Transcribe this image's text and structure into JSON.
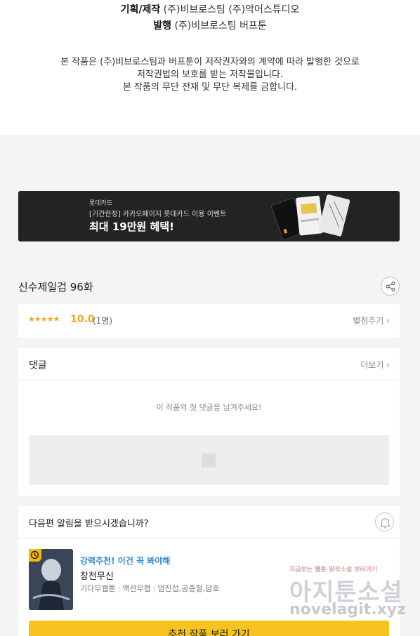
{
  "credits": {
    "planning_label": "기획/제작",
    "planning_value": "(주)비브로스팀   (주)악어스튜디오",
    "publish_label": "발행",
    "publish_value": "(주)비브로스팀   버프툰"
  },
  "notice": {
    "line1": "본 작품은 (주)비브로스팀과 버프툰이 저작권자와의 계약에 따라 발행한 것으로",
    "line2": "저작권법의 보호를 받는 저작물입니다.",
    "line3": "본 작품의 무단 전재 및 무단 복제를 금합니다."
  },
  "banner": {
    "brand": "롯데카드",
    "subtitle": "[기간한정] 카카오페이지 롯데카드 이용 이벤트",
    "headline": "최대 19만원 혜택!"
  },
  "episode": {
    "title": "신수제일검 96화"
  },
  "rating": {
    "stars": "★★★★★",
    "score": "10.0",
    "count": "(1명)",
    "rate_link": "별점주기 ›"
  },
  "comments": {
    "header": "댓글",
    "more_link": "더보기 ›",
    "empty_text": "이 작품의 첫 댓글을 남겨주세요!"
  },
  "notify": {
    "question": "다음편 알림을 받으시겠습니까?",
    "recommend_tag": "강력추천! 이건 꼭 봐야해",
    "work_title": "창천무신",
    "meta": [
      "기다무웹툰",
      "액션무협",
      "엄진섭,공종철,담호"
    ],
    "cta": "추천 작품 보러 가기"
  },
  "watermark": {
    "small": "지금보는 웹툰 원작소설 보러가기",
    "big": "아지툰소설",
    "url": "novelagit.xyz"
  }
}
